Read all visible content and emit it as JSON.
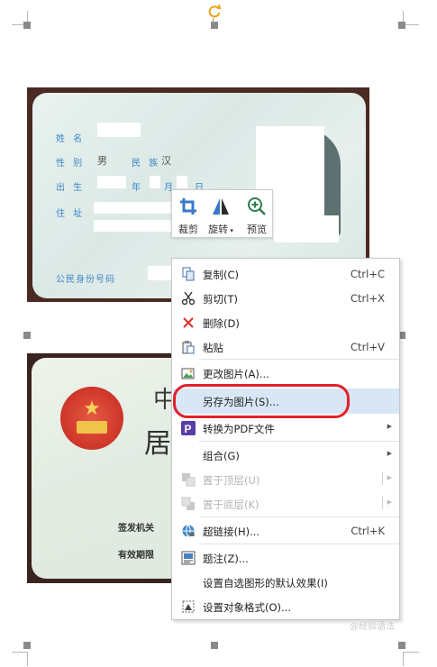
{
  "card_front": {
    "name_label": "姓 名",
    "gender_label": "性 别",
    "gender_value": "男",
    "ethnicity_label": "民 族",
    "ethnicity_value": "汉",
    "birth_label": "出 生",
    "year_label": "年",
    "month_label": "月",
    "day_label": "日",
    "address_label": "住 址",
    "id_number_label": "公民身份号码"
  },
  "card_back": {
    "title_char_1": "中",
    "title_char_2": "居",
    "issuer_label": "签发机关",
    "validity_label": "有效期限"
  },
  "mini_toolbar": {
    "crop": "裁剪",
    "rotate": "旋转",
    "preview": "预览"
  },
  "context_menu": {
    "copy": {
      "label": "复制(C)",
      "shortcut": "Ctrl+C"
    },
    "cut": {
      "label": "剪切(T)",
      "shortcut": "Ctrl+X"
    },
    "delete": {
      "label": "删除(D)"
    },
    "paste": {
      "label": "粘贴",
      "shortcut": "Ctrl+V"
    },
    "change_picture": {
      "label": "更改图片(A)..."
    },
    "save_as_picture": {
      "label": "另存为图片(S)..."
    },
    "convert_pdf": {
      "label": "转换为PDF文件"
    },
    "group": {
      "label": "组合(G)"
    },
    "bring_front": {
      "label": "置于顶层(U)"
    },
    "send_back": {
      "label": "置于底层(K)"
    },
    "hyperlink": {
      "label": "超链接(H)...",
      "shortcut": "Ctrl+K"
    },
    "caption": {
      "label": "题注(Z)..."
    },
    "set_default_shape": {
      "label": "设置自选图形的默认效果(I)"
    },
    "format_object": {
      "label": "设置对象格式(O)..."
    }
  },
  "watermark": "@经验语法",
  "colors": {
    "highlight": "#d8e6f5",
    "annotation_ring": "#e2202a",
    "rotate_handle": "#e8a317",
    "card_label_blue": "#3f86c6"
  }
}
